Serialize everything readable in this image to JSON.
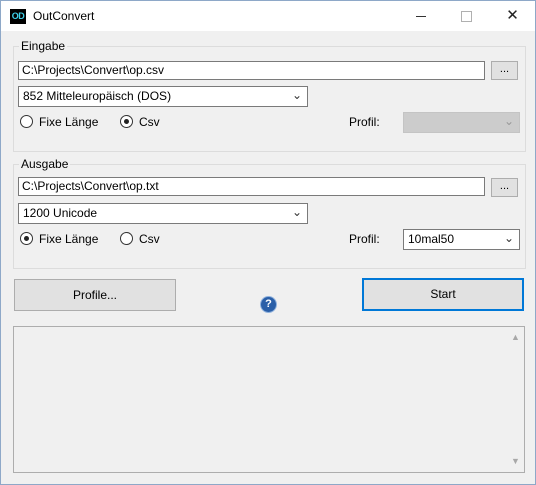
{
  "window": {
    "app_icon_text": "OD",
    "title": "OutConvert",
    "minimize_icon": "minimize-icon",
    "maximize_icon": "maximize-icon",
    "close_glyph": "✕"
  },
  "input_group": {
    "label": "Eingabe",
    "file_path": "C:\\Projects\\Convert\\op.csv",
    "browse_label": "...",
    "encoding": "852 Mitteleuropäisch (DOS)",
    "radio_fixed_label": "Fixe Länge",
    "radio_csv_label": "Csv",
    "selected_format": "Csv",
    "profile_label": "Profil:",
    "profile_value": "",
    "profile_enabled": false
  },
  "output_group": {
    "label": "Ausgabe",
    "file_path": "C:\\Projects\\Convert\\op.txt",
    "browse_label": "...",
    "encoding": "1200 Unicode",
    "radio_fixed_label": "Fixe Länge",
    "radio_csv_label": "Csv",
    "selected_format": "Fixe Länge",
    "profile_label": "Profil:",
    "profile_value": "10mal50",
    "profile_enabled": true
  },
  "buttons": {
    "profile_label": "Profile...",
    "help_glyph": "?",
    "start_label": "Start"
  },
  "log": {
    "text": "",
    "scroll_up_glyph": "▲",
    "scroll_down_glyph": "▼"
  },
  "colors": {
    "focus_accent": "#0078d7",
    "help_icon": "#2a5fa8",
    "disabled_combo": "#cccccc"
  }
}
